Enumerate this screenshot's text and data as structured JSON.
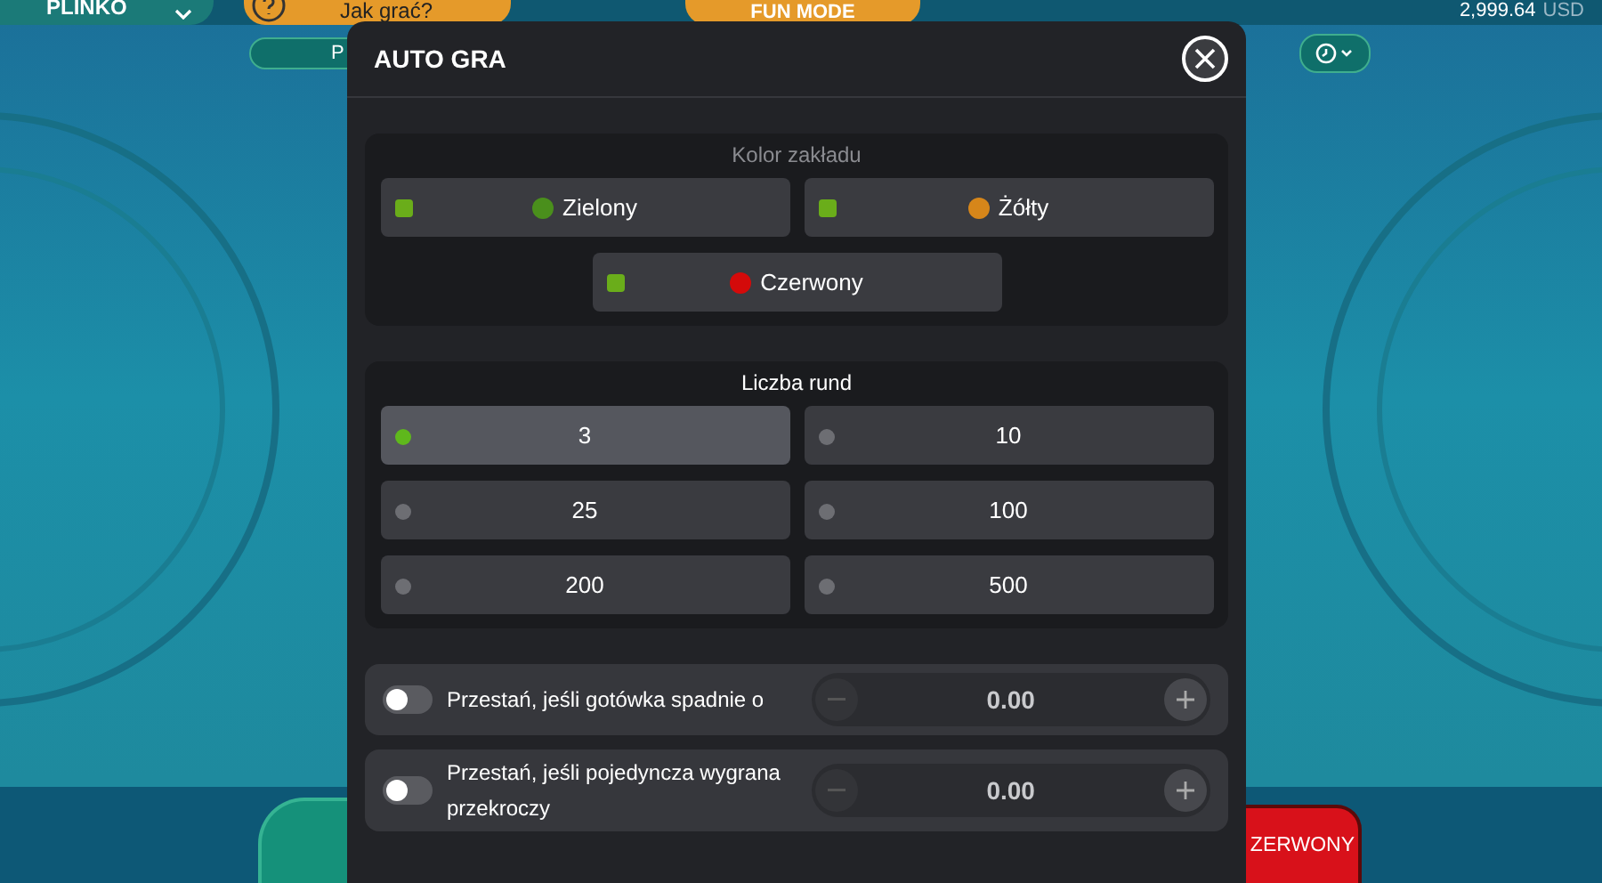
{
  "top_bar": {
    "game_select": "PLINKO",
    "help_button": "Jak grać?",
    "mode_tab": "FUN MODE",
    "balance": "2,999.64",
    "currency": "USD"
  },
  "second_row": {
    "pill": "P"
  },
  "bottom_bar": {
    "bet_button": "ZERWONY"
  },
  "dialog": {
    "title": "AUTO GRA",
    "bet_colors": {
      "title": "Kolor zakładu",
      "options": [
        {
          "label": "Zielony",
          "color": "#4a8f1c",
          "checked": true
        },
        {
          "label": "Żółty",
          "color": "#d6861a",
          "checked": true
        },
        {
          "label": "Czerwony",
          "color": "#d40a0a",
          "checked": true
        }
      ]
    },
    "rounds": {
      "title": "Liczba rund",
      "options": [
        {
          "label": "3",
          "selected": true
        },
        {
          "label": "10",
          "selected": false
        },
        {
          "label": "25",
          "selected": false
        },
        {
          "label": "100",
          "selected": false
        },
        {
          "label": "200",
          "selected": false
        },
        {
          "label": "500",
          "selected": false
        }
      ]
    },
    "stop_conditions": [
      {
        "label": "Przestań, jeśli gotówka spadnie o",
        "on": false,
        "value": "0.00"
      },
      {
        "label": "Przestań, jeśli pojedyncza wygrana przekroczy",
        "on": false,
        "value": "0.00"
      }
    ]
  }
}
